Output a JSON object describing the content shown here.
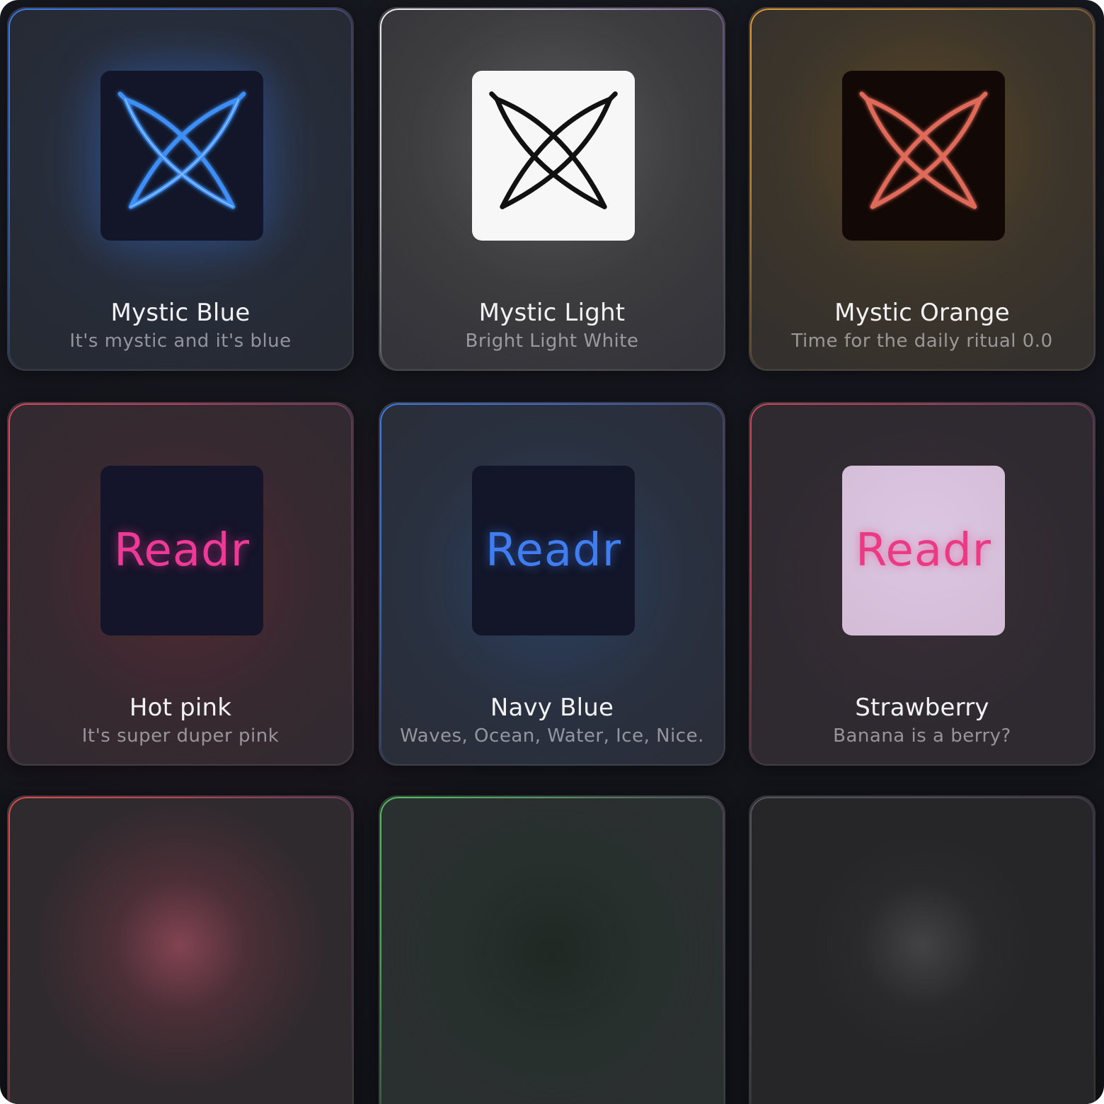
{
  "themes": [
    {
      "title": "Mystic Blue",
      "description": "It's mystic and it's blue",
      "icon": "mystic-star-icon",
      "icon_color": "#3d8ef5",
      "tile_bg": "#121628",
      "edge_color": "#3a7bf0"
    },
    {
      "title": "Mystic Light",
      "description": "Bright Light White",
      "icon": "mystic-star-icon",
      "icon_color": "#111111",
      "tile_bg": "#f7f7f7",
      "edge_color": "#e8e8ee"
    },
    {
      "title": "Mystic Orange",
      "description": "Time for the daily ritual 0.0",
      "icon": "mystic-star-icon",
      "icon_color": "#e06a5a",
      "tile_bg": "#120805",
      "edge_color": "#e09a36"
    },
    {
      "title": "Hot pink",
      "description": "It's super duper pink",
      "icon": "readr-logo",
      "logo_text": "Readr",
      "icon_color": "#ec3a96",
      "tile_bg": "#14142a",
      "edge_color": "#e0455f"
    },
    {
      "title": "Navy Blue",
      "description": "Waves, Ocean, Water, Ice, Nice.",
      "icon": "readr-logo",
      "logo_text": "Readr",
      "icon_color": "#3f7df0",
      "tile_bg": "#131629",
      "edge_color": "#3d7bf0"
    },
    {
      "title": "Strawberry",
      "description": "Banana is a berry?",
      "icon": "readr-logo",
      "logo_text": "Readr",
      "icon_color": "#ea3a84",
      "tile_bg": "#d9c0dd",
      "edge_color": "#d2455a"
    },
    {
      "edge_color": "#e24a4a"
    },
    {
      "edge_color": "#4fc25c"
    },
    {
      "edge_color": "#6b6b78"
    }
  ]
}
